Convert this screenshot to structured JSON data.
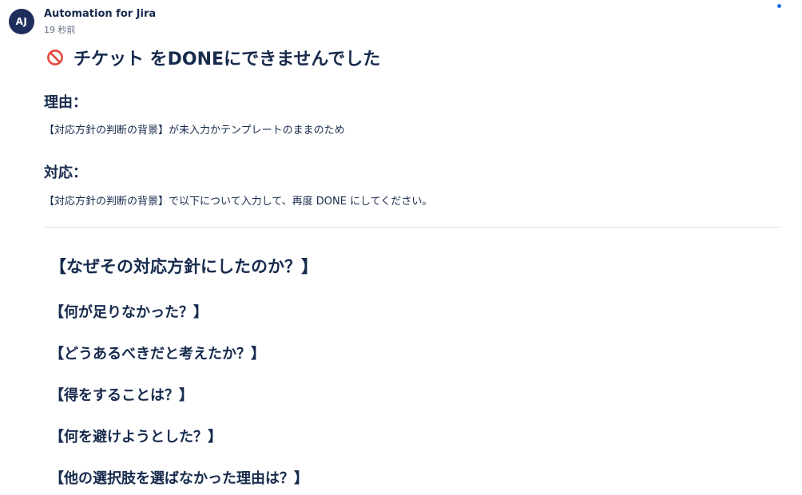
{
  "comment": {
    "avatar_initials": "AJ",
    "author": "Automation for Jira",
    "timestamp": "19 秒前",
    "unread_indicator_color": "#1f6fe0",
    "headline_icon": "prohibited-icon",
    "headline": "チケット をDONEにできませんでした",
    "reason_heading": "理由：",
    "reason_text": "【対応方針の判断の背景】が未入力かテンプレートのままのため",
    "action_heading": "対応：",
    "action_text": "【対応方針の判断の背景】で以下について入力して、再度 DONE にしてください。",
    "template": {
      "title": "【なぜその対応方針にしたのか？】",
      "questions": [
        "【何が足りなかった？】",
        "【どうあるべきだと考えたか？】",
        "【得をすることは？】",
        "【何を避けようとした？】",
        "【他の選択肢を選ばなかった理由は？】"
      ]
    }
  }
}
